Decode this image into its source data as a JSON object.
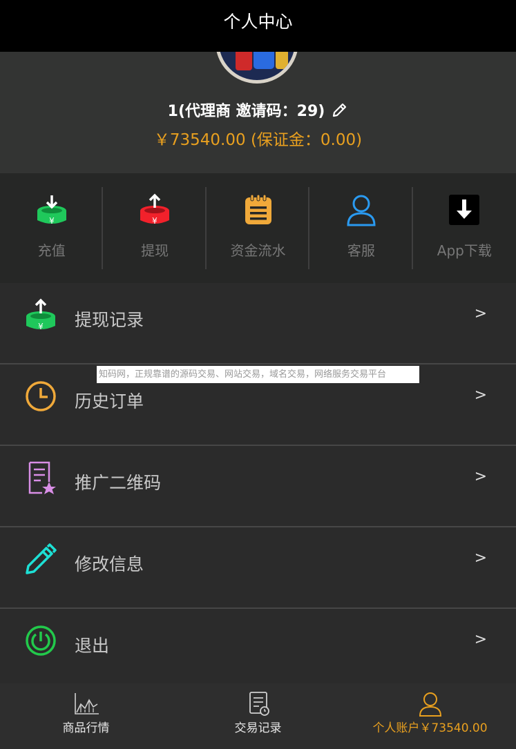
{
  "header": {
    "title": "个人中心"
  },
  "profile": {
    "user_line": "1(代理商 邀请码：29)",
    "balance_line": "￥73540.00 (保证金：0.00)"
  },
  "quick_actions": [
    {
      "label": "充值",
      "icon": "recharge-icon",
      "color": "#1fc85b"
    },
    {
      "label": "提现",
      "icon": "withdraw-icon",
      "color": "#f2212b"
    },
    {
      "label": "资金流水",
      "icon": "funds-flow-icon",
      "color": "#f0a93a"
    },
    {
      "label": "客服",
      "icon": "customer-service-icon",
      "color": "#2a9af0"
    },
    {
      "label": "App下载",
      "icon": "app-download-icon",
      "color": "#000000"
    }
  ],
  "menu": [
    {
      "label": "提现记录",
      "icon": "withdraw-record-icon",
      "arrow": ">"
    },
    {
      "label": "历史订单",
      "icon": "clock-icon",
      "arrow": ">"
    },
    {
      "label": "推广二维码",
      "icon": "promo-qrcode-icon",
      "arrow": ">"
    },
    {
      "label": "修改信息",
      "icon": "edit-info-icon",
      "arrow": ">"
    },
    {
      "label": "退出",
      "icon": "power-icon",
      "arrow": ">"
    }
  ],
  "watermark": "知码网，正规靠谱的源码交易、网站交易，域名交易，网络服务交易平台",
  "tabbar": [
    {
      "label": "商品行情",
      "icon": "market-chart-icon"
    },
    {
      "label": "交易记录",
      "icon": "trade-record-icon"
    },
    {
      "label": "个人账户￥73540.00",
      "icon": "account-icon",
      "active": true
    }
  ],
  "colors": {
    "accent": "#e9a01f",
    "background": "#2b2b2b",
    "header": "#000000"
  }
}
